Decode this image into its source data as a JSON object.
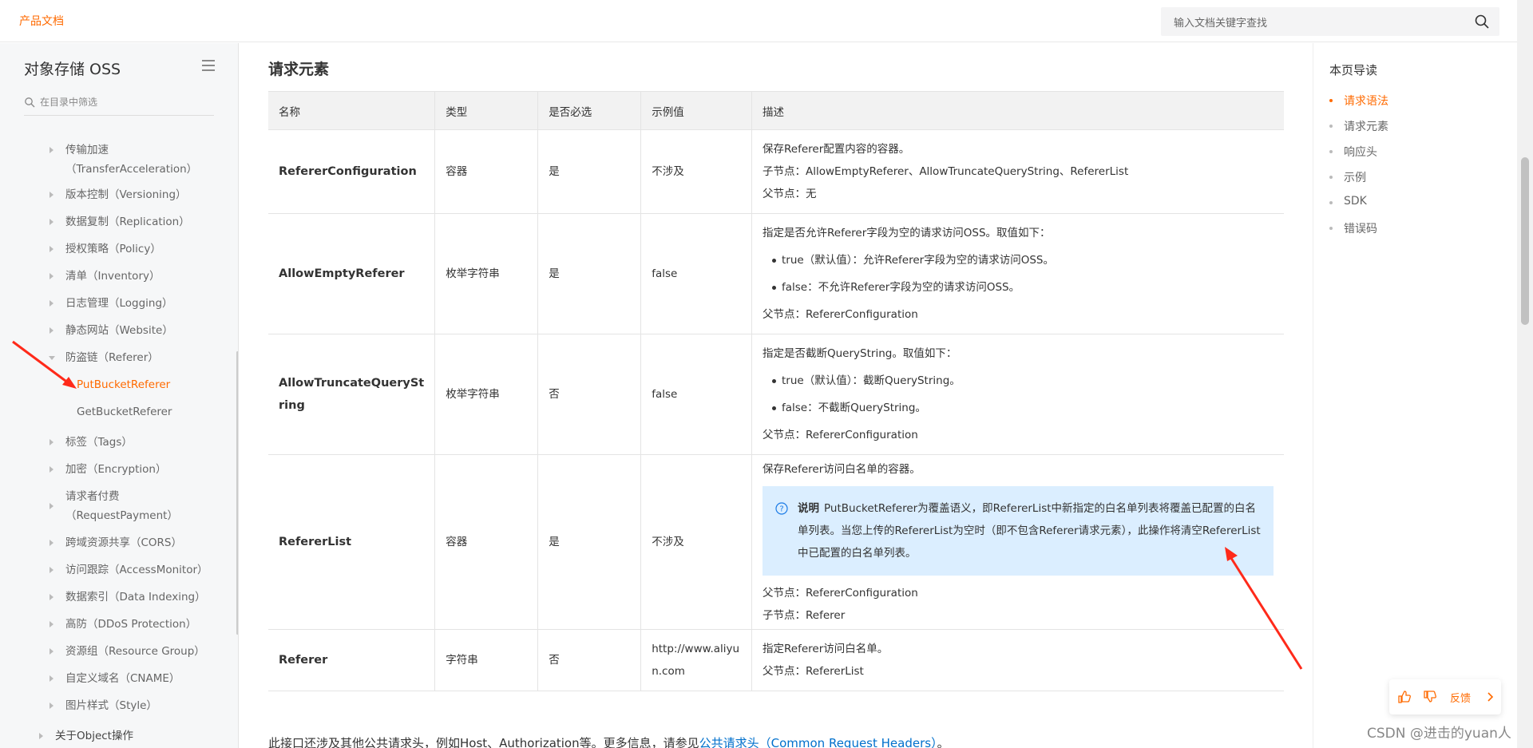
{
  "header": {
    "brand": "产品文档",
    "search_placeholder": "输入文档关键字查找"
  },
  "sidebar": {
    "title": "对象存储 OSS",
    "filter_placeholder": "在目录中筛选",
    "items": [
      {
        "label": "传输加速\n（TransferAcceleration）"
      },
      {
        "label": "版本控制（Versioning）"
      },
      {
        "label": "数据复制（Replication）"
      },
      {
        "label": "授权策略（Policy）"
      },
      {
        "label": "清单（Inventory）"
      },
      {
        "label": "日志管理（Logging）"
      },
      {
        "label": "静态网站（Website）"
      },
      {
        "label": "防盗链（Referer）"
      },
      {
        "label": "标签（Tags）"
      },
      {
        "label": "加密（Encryption）"
      },
      {
        "label": "请求者付费\n（RequestPayment）"
      },
      {
        "label": "跨域资源共享（CORS）"
      },
      {
        "label": "访问跟踪（AccessMonitor）"
      },
      {
        "label": "数据索引（Data Indexing）"
      },
      {
        "label": "高防（DDoS Protection）"
      },
      {
        "label": "资源组（Resource Group）"
      },
      {
        "label": "自定义域名（CNAME）"
      },
      {
        "label": "图片样式（Style）"
      }
    ],
    "children": [
      {
        "label": "PutBucketReferer"
      },
      {
        "label": "GetBucketReferer"
      }
    ],
    "bottom_item": "关于Object操作"
  },
  "main": {
    "section_title": "请求元素",
    "table": {
      "headers": [
        "名称",
        "类型",
        "是否必选",
        "示例值",
        "描述"
      ],
      "rows": [
        {
          "name": "RefererConfiguration",
          "type": "容器",
          "required": "是",
          "example": "不涉及",
          "d1": "保存Referer配置内容的容器。",
          "d2": "子节点：AllowEmptyReferer、AllowTruncateQueryString、RefererList",
          "d3": "父节点：无"
        },
        {
          "name": "AllowEmptyReferer",
          "type": "枚举字符串",
          "required": "是",
          "example": "false",
          "d1": "指定是否允许Referer字段为空的请求访问OSS。取值如下：",
          "li1": "true（默认值）：允许Referer字段为空的请求访问OSS。",
          "li2": "false：不允许Referer字段为空的请求访问OSS。",
          "d2": "父节点：RefererConfiguration"
        },
        {
          "name1": "AllowTruncateQuerySt",
          "name2": "ring",
          "type": "枚举字符串",
          "required": "否",
          "example": "false",
          "d1": "指定是否截断QueryString。取值如下：",
          "li1": "true（默认值）：截断QueryString。",
          "li2": "false：不截断QueryString。",
          "d2": "父节点：RefererConfiguration"
        },
        {
          "name": "RefererList",
          "type": "容器",
          "required": "是",
          "example": "不涉及",
          "d1": "保存Referer访问白名单的容器。",
          "note_label": "说明",
          "note_text": "PutBucketReferer为覆盖语义，即RefererList中新指定的白名单列表将覆盖已配置的白名单列表。当您上传的RefererList为空时（即不包含Referer请求元素），此操作将清空RefererList中已配置的白名单列表。",
          "d2": "父节点：RefererConfiguration",
          "d3": "子节点：Referer"
        },
        {
          "name": "Referer",
          "type": "字符串",
          "required": "否",
          "example1": "http://www.aliyu",
          "example2": "n.com",
          "d1": "指定Referer访问白名单。",
          "d2": "父节点：RefererList"
        }
      ]
    },
    "footer_text": "此接口还涉及其他公共请求头，例如Host、Authorization等。更多信息，请参见",
    "footer_link": "公共请求头（Common Request Headers）",
    "footer_end": "。"
  },
  "toc": {
    "title": "本页导读",
    "items": [
      "请求语法",
      "请求元素",
      "响应头",
      "示例",
      "SDK",
      "错误码"
    ]
  },
  "feedback": {
    "label": "反馈"
  },
  "watermark": "CSDN @进击的yuan人",
  "colors": {
    "accent": "#ff6a00",
    "link": "#0070cc",
    "note_bg": "#dbeeff",
    "arrow": "#ff2a1a"
  }
}
